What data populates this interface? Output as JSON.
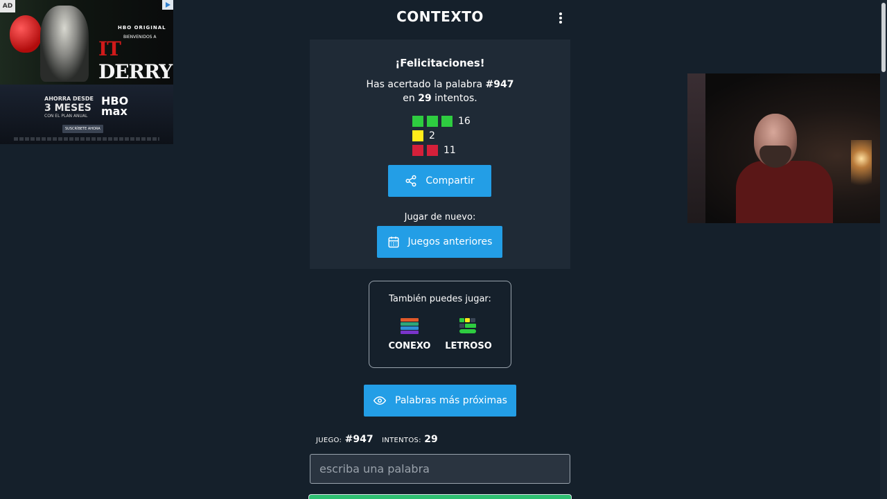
{
  "ad": {
    "tag": "AD",
    "hbo_original": "HBO ORIGINAL",
    "bienvenidos": "BIENVENIDOS A",
    "derry_it": "IT",
    "derry": "DERRY",
    "ahorra": "AHORRA DESDE",
    "meses": "3 MESES",
    "plan": "CON EL PLAN ANUAL",
    "brand_hbo": "HBO",
    "brand_max": "max",
    "cta": "SUSCRÍBETE AHORA"
  },
  "header": {
    "title": "CONTEXTO"
  },
  "result": {
    "congrats": "¡Felicitaciones!",
    "line1_prefix": "Has acertado la palabra ",
    "game_number": "#947",
    "line2_prefix": "en ",
    "attempts": "29",
    "line2_suffix": " intentos.",
    "stats": [
      {
        "color": "green",
        "count": "16"
      },
      {
        "color": "yellow",
        "count": "2"
      },
      {
        "color": "red",
        "count": "11"
      }
    ],
    "share_label": "Compartir",
    "replay_label": "Jugar de nuevo:",
    "previous_games_label": "Juegos anteriores"
  },
  "other_games": {
    "title": "También puedes jugar:",
    "conexo": "CONEXO",
    "letroso": "LETROSO"
  },
  "nearest_words_label": "Palabras más próximas",
  "meta": {
    "game_label": "JUEGO:",
    "game_value": "#947",
    "attempts_label": "INTENTOS:",
    "attempts_value": "29"
  },
  "input": {
    "placeholder": "escriba una palabra"
  },
  "colors": {
    "background": "#15202b",
    "card": "#1f2a36",
    "accent": "#239ee6",
    "green": "#2ecc40",
    "yellow": "#ffeb1a",
    "red": "#d5203a"
  }
}
